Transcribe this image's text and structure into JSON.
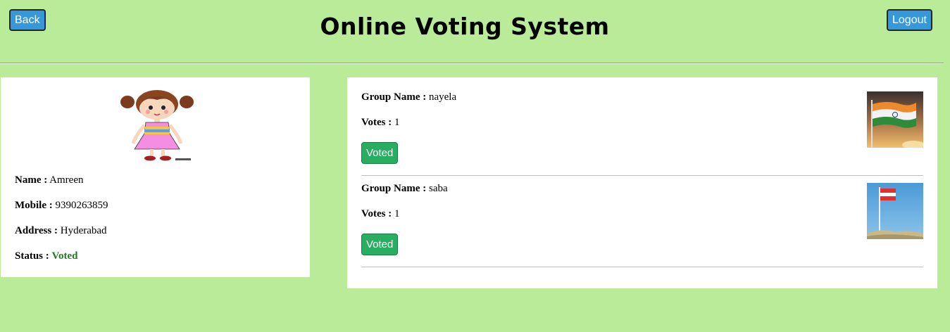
{
  "header": {
    "back_label": "Back",
    "logout_label": "Logout",
    "title": "Online Voting System"
  },
  "profile": {
    "avatar_icon": "girl-cartoon-avatar",
    "name_label": "Name :",
    "name": "Amreen",
    "mobile_label": "Mobile :",
    "mobile": "9390263859",
    "address_label": "Address :",
    "address": "Hyderabad",
    "status_label": "Status :",
    "status": "Voted",
    "status_color": "#1e7d1e"
  },
  "groups": [
    {
      "group_label": "Group Name :",
      "group_name": "nayela",
      "votes_label": "Votes :",
      "votes": "1",
      "button_label": "Voted",
      "flag_icon": "india-flag-image"
    },
    {
      "group_label": "Group Name :",
      "group_name": "saba",
      "votes_label": "Votes :",
      "votes": "1",
      "button_label": "Voted",
      "flag_icon": "austria-flag-image"
    }
  ],
  "colors": {
    "background": "#b9eb98",
    "button_blue": "#3498db",
    "button_green": "#27ae60"
  }
}
